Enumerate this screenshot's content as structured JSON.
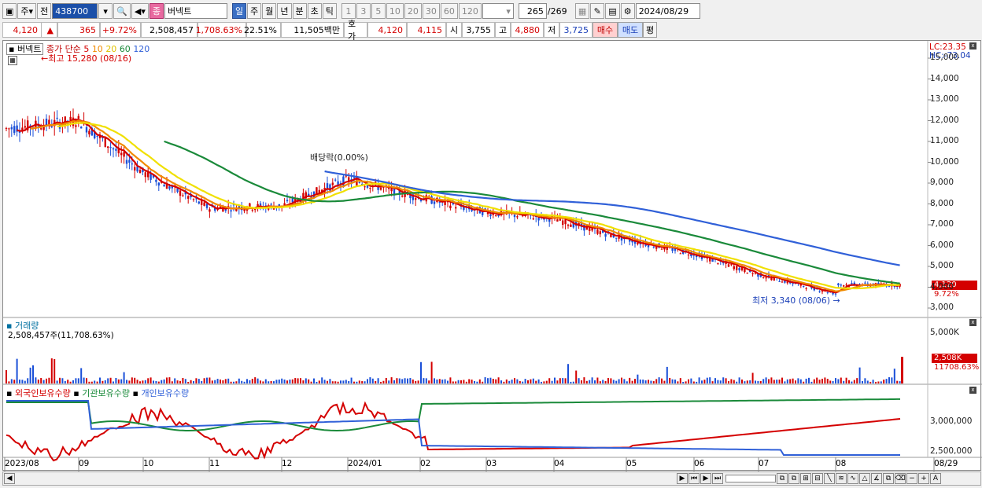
{
  "toolbar": {
    "period_main": "주",
    "prev": "전",
    "code": "438700",
    "stock_name": "버넥트",
    "stock_badge": "종",
    "periods": [
      "일",
      "주",
      "월",
      "년",
      "분",
      "초",
      "틱"
    ],
    "intervals": [
      "1",
      "3",
      "5",
      "10",
      "20",
      "30",
      "60",
      "120"
    ],
    "count": "265",
    "count_total": "/269",
    "date": "2024/08/29"
  },
  "quote": {
    "price": "4,120",
    "arrow": "▲",
    "change": "365",
    "change_pct": "+9.72%",
    "volume": "2,508,457",
    "volume_pct": "1,708.63%",
    "turnover": "22.51%",
    "trade_value": "11,505백만",
    "ask_label": "호가",
    "ask": "4,120",
    "bid": "4,115",
    "open_label": "시",
    "open": "3,755",
    "high_label": "고",
    "high": "4,880",
    "low_label": "저",
    "low": "3,725",
    "buy": "매수",
    "sell": "매도",
    "eval": "평"
  },
  "price_panel": {
    "name": "버넥트",
    "ma_title": "종가 단순",
    "ma_periods": [
      "5",
      "10",
      "20",
      "60",
      "120"
    ],
    "ma_colors": [
      "#d40000",
      "#f08a00",
      "#f0e000",
      "#1a8a3a",
      "#3060d8"
    ],
    "high_note": "최고 15,280 (08/16)",
    "low_note": "최저 3,340 (08/06)",
    "dividend_note": "배당락(0.00%)",
    "lc": "LC:23.35",
    "hc": "HC:-73.04",
    "last_price": "4,120",
    "last_pct": "9.72%",
    "y_ticks": [
      "15,000",
      "14,000",
      "13,000",
      "12,000",
      "11,000",
      "10,000",
      "9,000",
      "8,000",
      "7,000",
      "6,000",
      "5,000",
      "4,000",
      "3,000"
    ]
  },
  "volume_panel": {
    "title": "거래량",
    "value": "2,508,457주(11,708.63%)",
    "y_tick": "5,000K",
    "last": "2,508K",
    "last_pct": "11708.63%"
  },
  "holding_panel": {
    "legend": [
      "외국인보유수량",
      "기관보유수량",
      "개인보유수량"
    ],
    "colors": [
      "#d40000",
      "#1a8a3a",
      "#3060d8"
    ],
    "y_ticks": [
      "3,000,000",
      "2,500,000"
    ]
  },
  "x_labels": [
    "2023/08",
    "09",
    "10",
    "11",
    "12",
    "2024/01",
    "02",
    "03",
    "04",
    "05",
    "06",
    "07",
    "08",
    "08/29"
  ],
  "chart_data": {
    "type": "line",
    "x": [
      "2023/08",
      "2023/09",
      "2023/10",
      "2023/11",
      "2023/12",
      "2024/01",
      "2024/02",
      "2024/03",
      "2024/04",
      "2024/05",
      "2024/06",
      "2024/07",
      "2024/08",
      "08/29"
    ],
    "series": [
      {
        "name": "종가 (approx)",
        "values": [
          11600,
          12000,
          9500,
          7800,
          7900,
          9200,
          8300,
          7600,
          7300,
          6300,
          5600,
          4600,
          3700,
          4120
        ]
      }
    ],
    "ylim": [
      3000,
      15280
    ]
  }
}
